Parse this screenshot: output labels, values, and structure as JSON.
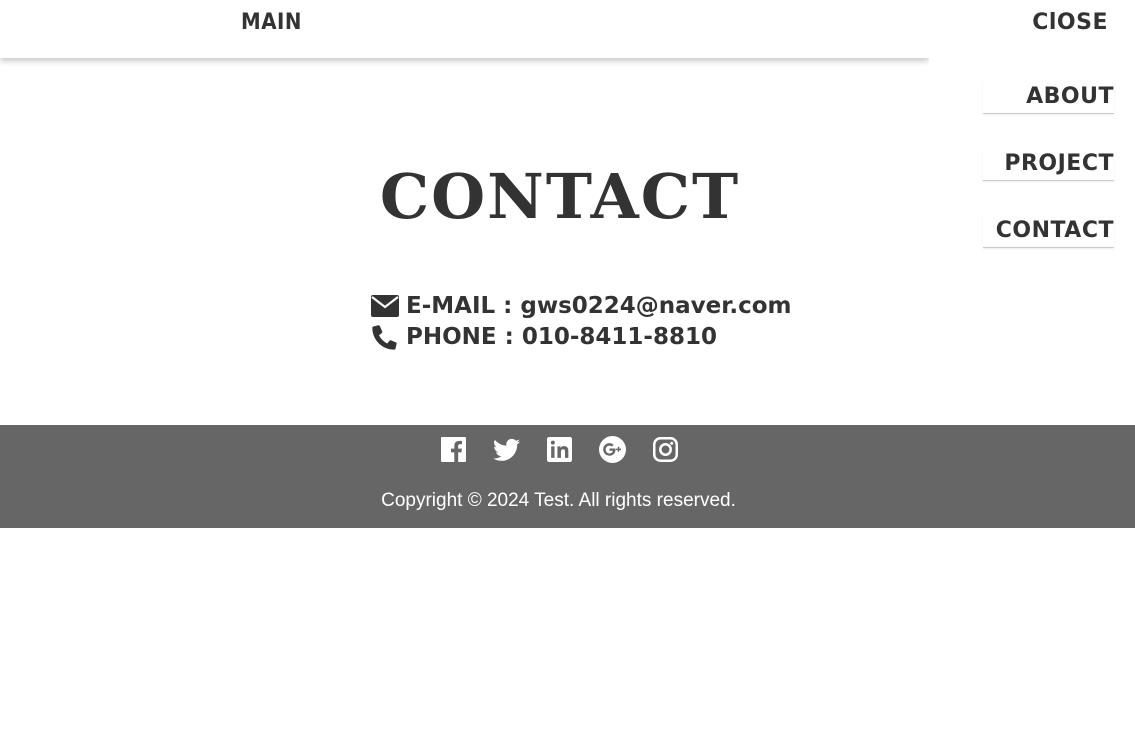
{
  "header": {
    "main_label": "MAIN"
  },
  "sidenav": {
    "close_label": "ClOSE",
    "items": [
      {
        "label": "ABOUT"
      },
      {
        "label": "PROJECT"
      },
      {
        "label": "CONTACT"
      }
    ]
  },
  "main": {
    "title": "CONTACT",
    "email_line": "E-MAIL : gws0224@naver.com",
    "phone_line": "PHONE : 010-8411-8810",
    "email_icon": "envelope-icon",
    "phone_icon": "phone-icon"
  },
  "footer": {
    "social_icons": [
      "facebook-icon",
      "twitter-icon",
      "linkedin-icon",
      "google-plus-icon",
      "instagram-icon"
    ],
    "copyright": "Copyright © 2024 Test. All rights reserved."
  },
  "colors": {
    "text": "#333333",
    "footer_bg": "#666666",
    "footer_text": "#ffffff"
  }
}
